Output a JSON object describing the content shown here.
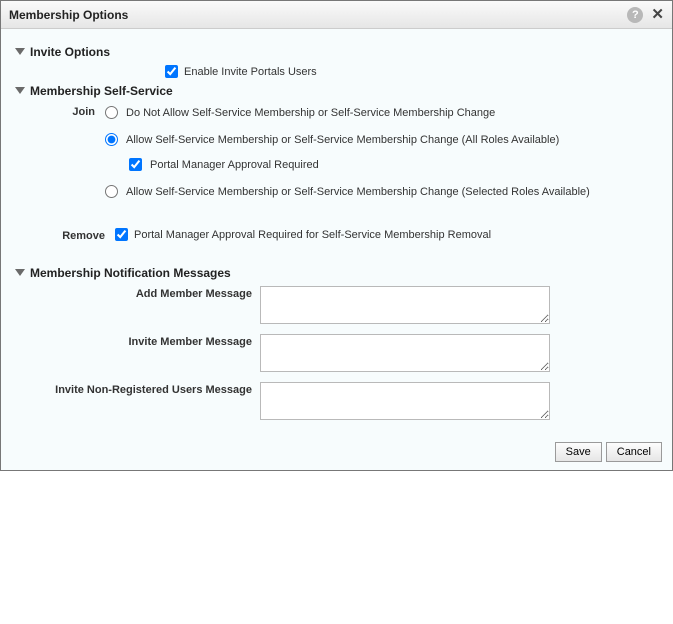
{
  "dialog": {
    "title": "Membership Options"
  },
  "sections": {
    "invite": {
      "title": "Invite Options",
      "enable_invite_label": "Enable Invite Portals Users",
      "enable_invite_checked": true
    },
    "self_service": {
      "title": "Membership Self-Service",
      "join_label": "Join",
      "join_options": {
        "no_allow": "Do Not Allow Self-Service Membership or Self-Service Membership Change",
        "allow_all": "Allow Self-Service Membership or Self-Service Membership Change (All Roles Available)",
        "allow_selected": "Allow Self-Service Membership or Self-Service Membership Change (Selected Roles Available)"
      },
      "join_selected": "allow_all",
      "approval_required_label": "Portal Manager Approval Required",
      "approval_required_checked": true,
      "remove_label": "Remove",
      "remove_approval_label": "Portal Manager Approval Required for Self-Service Membership Removal",
      "remove_approval_checked": true
    },
    "notifications": {
      "title": "Membership Notification Messages",
      "add_member_label": "Add Member Message",
      "add_member_value": "",
      "invite_member_label": "Invite Member Message",
      "invite_member_value": "",
      "invite_nonreg_label": "Invite Non-Registered Users Message",
      "invite_nonreg_value": ""
    }
  },
  "buttons": {
    "save": "Save",
    "cancel": "Cancel"
  }
}
